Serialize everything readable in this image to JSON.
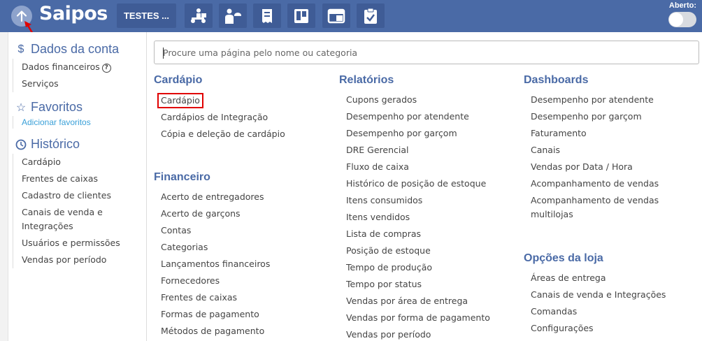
{
  "header": {
    "brand": "Saipos",
    "store_button": "TESTES ...",
    "status_label": "Aberto:",
    "tools": [
      "delivery-icon",
      "waiter-icon",
      "receipt-icon",
      "board-icon",
      "window-icon",
      "clipboard-check-icon"
    ]
  },
  "colors": {
    "topbar": "#4a6aa6",
    "accent": "#4a6aa6",
    "link": "#3aa0d8",
    "highlight": "#e00000"
  },
  "sidebar": {
    "account": {
      "title": "Dados da conta",
      "icon": "dollar-icon",
      "items": [
        "Dados financeiros",
        "Serviços"
      ]
    },
    "favorites": {
      "title": "Favoritos",
      "icon": "star-icon",
      "link": "Adicionar favoritos"
    },
    "history": {
      "title": "Histórico",
      "icon": "clock-icon",
      "items": [
        "Cardápio",
        "Frentes de caixas",
        "Cadastro de clientes",
        "Canais de venda e Integrações",
        "Usuários e permissões",
        "Vendas por período"
      ]
    }
  },
  "search": {
    "placeholder": "Procure uma página pelo nome ou categoria",
    "value": ""
  },
  "columns": {
    "cardapio": {
      "title": "Cardápio",
      "items": [
        "Cardápio",
        "Cardápios de Integração",
        "Cópia e deleção de cardápio"
      ]
    },
    "financeiro": {
      "title": "Financeiro",
      "items": [
        "Acerto de entregadores",
        "Acerto de garçons",
        "Contas",
        "Categorias",
        "Lançamentos financeiros",
        "Fornecedores",
        "Frentes de caixas",
        "Formas de pagamento",
        "Métodos de pagamento"
      ]
    },
    "relatorios": {
      "title": "Relatórios",
      "items": [
        "Cupons gerados",
        "Desempenho por atendente",
        "Desempenho por garçom",
        "DRE Gerencial",
        "Fluxo de caixa",
        "Histórico de posição de estoque",
        "Itens consumidos",
        "Itens vendidos",
        "Lista de compras",
        "Posição de estoque",
        "Tempo de produção",
        "Tempo por status",
        "Vendas por área de entrega",
        "Vendas por forma de pagamento",
        "Vendas por período"
      ]
    },
    "dashboards": {
      "title": "Dashboards",
      "items": [
        "Desempenho por atendente",
        "Desempenho por garçom",
        "Faturamento",
        "Canais",
        "Vendas por Data / Hora",
        "Acompanhamento de vendas",
        "Acompanhamento de vendas multilojas"
      ]
    },
    "opcoes": {
      "title": "Opções da loja",
      "items": [
        "Áreas de entrega",
        "Canais de venda e Integrações",
        "Comandas",
        "Configurações"
      ]
    }
  }
}
